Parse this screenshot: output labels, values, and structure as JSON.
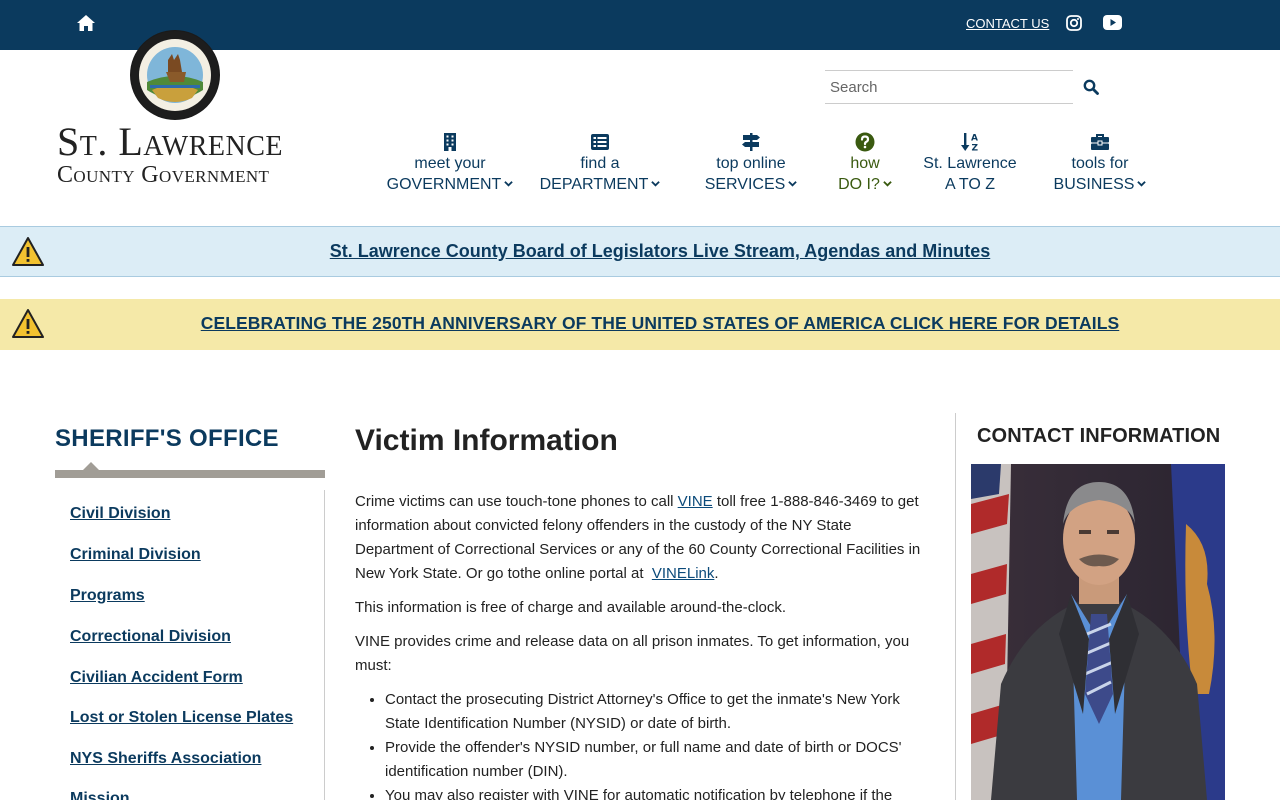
{
  "topbar": {
    "contact_label": "CONTACT US",
    "color": "#0b3a5e"
  },
  "logo": {
    "line1": "St. Lawrence",
    "line2": "County Government",
    "seal_text": "COUNTY OF ST. LAWRENCE"
  },
  "search": {
    "placeholder": "Search",
    "value": ""
  },
  "nav": [
    {
      "line1": "meet your",
      "line2": "GOVERNMENT",
      "icon": "building-icon"
    },
    {
      "line1": "find a",
      "line2": "DEPARTMENT",
      "icon": "list-icon"
    },
    {
      "line1": "top online",
      "line2": "SERVICES",
      "icon": "signpost-icon"
    },
    {
      "line1": "how",
      "line2": "DO I?",
      "icon": "question-circle-icon"
    },
    {
      "line1": "St. Lawrence",
      "line2": "A TO Z",
      "icon": "sort-alpha-icon"
    },
    {
      "line1": "tools for",
      "line2": "BUSINESS",
      "icon": "toolbox-icon"
    }
  ],
  "alerts": [
    {
      "text": "St. Lawrence County Board of Legislators Live Stream, Agendas and Minutes",
      "color": "#dcedf6"
    },
    {
      "text": "CELEBRATING THE 250TH ANNIVERSARY OF THE UNITED STATES OF AMERICA CLICK HERE FOR DETAILS",
      "color": "#f5e9a8"
    }
  ],
  "sidebar": {
    "title": "SHERIFF'S OFFICE",
    "items": [
      "Civil Division",
      "Criminal Division",
      "Programs",
      "Correctional Division",
      "Civilian Accident Form",
      "Lost or Stolen License Plates",
      "NYS Sheriffs Association",
      "Mission"
    ]
  },
  "main": {
    "title": "Victim Information",
    "p1_a": "Crime victims can use touch-tone phones to call ",
    "p1_link": "VINE",
    "p1_b": " toll free 1-888-846-3469 to get information about convicted felony offenders in the custody of the NY State Department of Correctional Services or any of the 60 County Correctional Facilities in New York State. Or go tothe online portal at  ",
    "p1_link2": "VINELink",
    "p1_c": ".",
    "p2": "This information is free of charge and available around-the-clock.",
    "p3": "VINE provides crime and release data on all prison inmates. To get information, you must:",
    "bullets": [
      "Contact the prosecuting District Attorney's Office to get the inmate's New York State Identification Number (NYSID) or date of birth.",
      "Provide the offender's NYSID number, or full name and date of birth or DOCS' identification number (DIN).",
      "You may also register with VINE for automatic notification by telephone if the"
    ]
  },
  "right": {
    "title": "CONTACT INFORMATION"
  }
}
